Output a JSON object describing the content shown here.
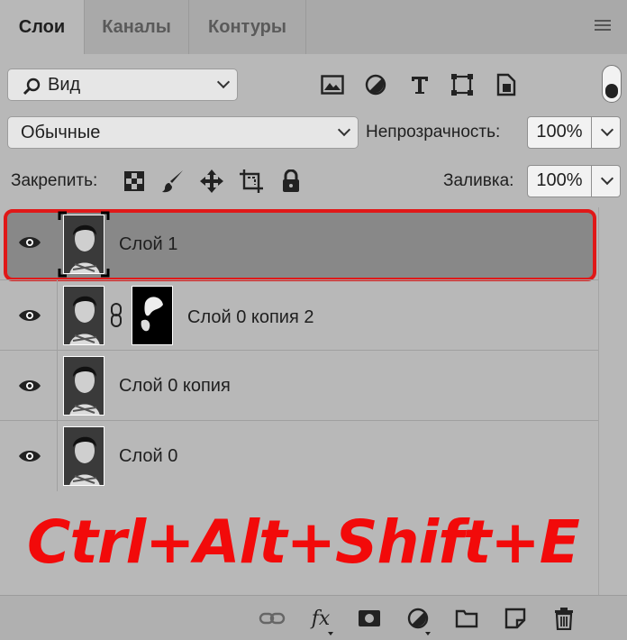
{
  "tabs": [
    {
      "label": "Слои"
    },
    {
      "label": "Каналы"
    },
    {
      "label": "Контуры"
    }
  ],
  "filter": {
    "icon": "search-icon",
    "label": "Вид"
  },
  "filter_icons": [
    "image-filter-icon",
    "adjustment-filter-icon",
    "type-filter-icon",
    "shape-filter-icon",
    "smart-object-filter-icon"
  ],
  "blend": {
    "mode": "Обычные"
  },
  "opacity": {
    "label": "Непрозрачность:",
    "value": "100%"
  },
  "lock": {
    "label": "Закрепить:",
    "icons": [
      "lock-transparent-pixels-icon",
      "lock-image-pixels-icon",
      "lock-position-icon",
      "lock-artboard-icon",
      "lock-all-icon"
    ]
  },
  "fill": {
    "label": "Заливка:",
    "value": "100%"
  },
  "layers": [
    {
      "name": "Слой 1",
      "selected": true,
      "has_mask": false
    },
    {
      "name": "Слой 0 копия 2",
      "selected": false,
      "has_mask": true
    },
    {
      "name": "Слой 0 копия",
      "selected": false,
      "has_mask": false
    },
    {
      "name": "Слой 0",
      "selected": false,
      "has_mask": false
    }
  ],
  "shortcut": "Ctrl+Alt+Shift+E",
  "bottom_icons": [
    "link-layers-icon",
    "fx-icon",
    "add-mask-icon",
    "adjustment-layer-icon",
    "group-folder-icon",
    "new-layer-icon",
    "trash-icon"
  ],
  "fx_label": "fx",
  "colors": {
    "selection_outline": "#e01818",
    "shortcut_text": "#f20a0a",
    "panel_bg": "#b8b8b8",
    "selected_row": "#888888"
  }
}
